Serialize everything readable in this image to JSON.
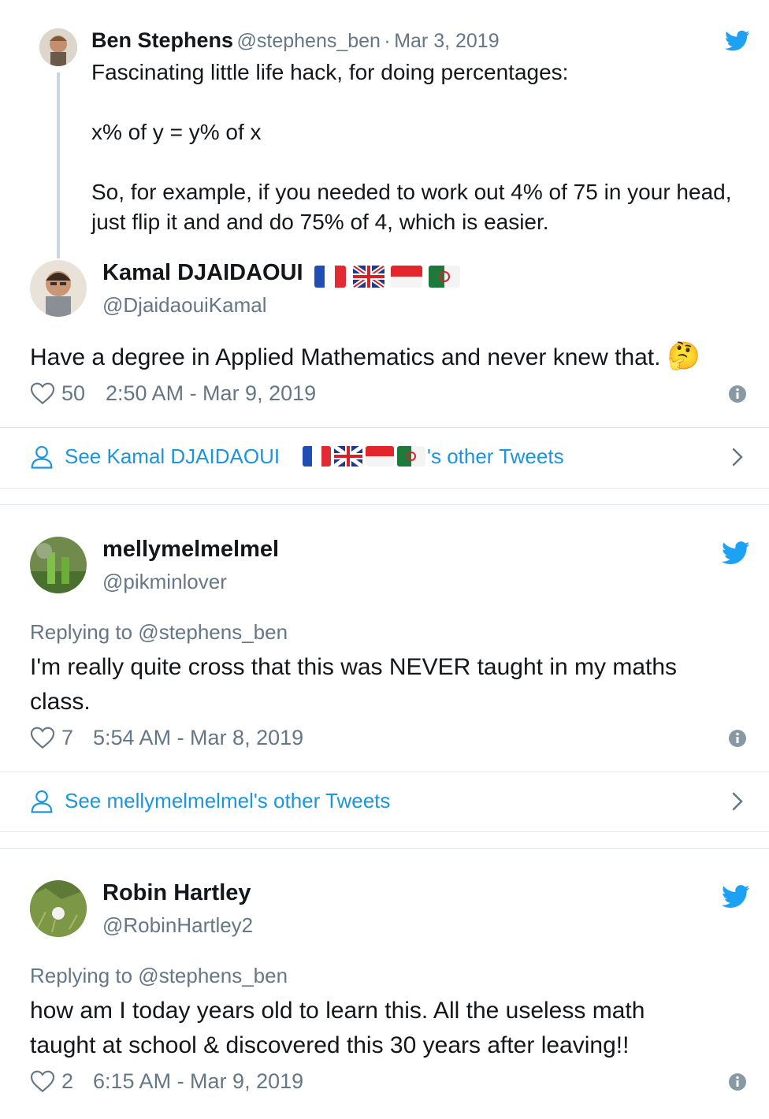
{
  "colors": {
    "twitter_blue": "#1da1f2",
    "link_blue": "#1b95e0",
    "muted": "#657786",
    "border": "#e1e8ed"
  },
  "quoted": {
    "name": "Ben Stephens",
    "handle": "@stephens_ben",
    "sep": "·",
    "date": "Mar 3, 2019",
    "lines": [
      "Fascinating little life hack, for doing percentages:",
      "x% of y = y% of x",
      "So, for example, if you needed to work out 4% of 75 in your head,",
      "just flip it and and do 75% of 4, which is easier."
    ]
  },
  "tweets": [
    {
      "name": "Kamal DJAIDAOUI",
      "handle": "@DjaidaouiKamal",
      "text": "Have a degree in Applied Mathematics and never knew that.",
      "emoji": "🤔",
      "likes": "50",
      "time": "2:50 AM - Mar 9, 2019",
      "see_prefix": "See Kamal DJAIDAOUI",
      "see_suffix": "'s other Tweets"
    },
    {
      "name": "mellymelmelmel",
      "handle": "@pikminlover",
      "replying": "Replying to @stephens_ben",
      "text_lines": [
        "I'm really quite cross that this was NEVER taught in my maths",
        "class."
      ],
      "likes": "7",
      "time": "5:54 AM - Mar 8, 2019",
      "see": "See mellymelmelmel's other Tweets"
    },
    {
      "name": "Robin Hartley",
      "handle": "@RobinHartley2",
      "replying": "Replying to @stephens_ben",
      "text_lines": [
        "how am I today years old to learn this. All the useless math",
        "taught at school & discovered this 30 years after leaving!!"
      ],
      "likes": "2",
      "time": "6:15 AM - Mar 9, 2019"
    }
  ],
  "icons": {
    "twitter": "twitter-bird-icon",
    "heart": "heart-icon",
    "info": "info-icon",
    "person": "person-icon",
    "chevron": "chevron-right-icon"
  }
}
